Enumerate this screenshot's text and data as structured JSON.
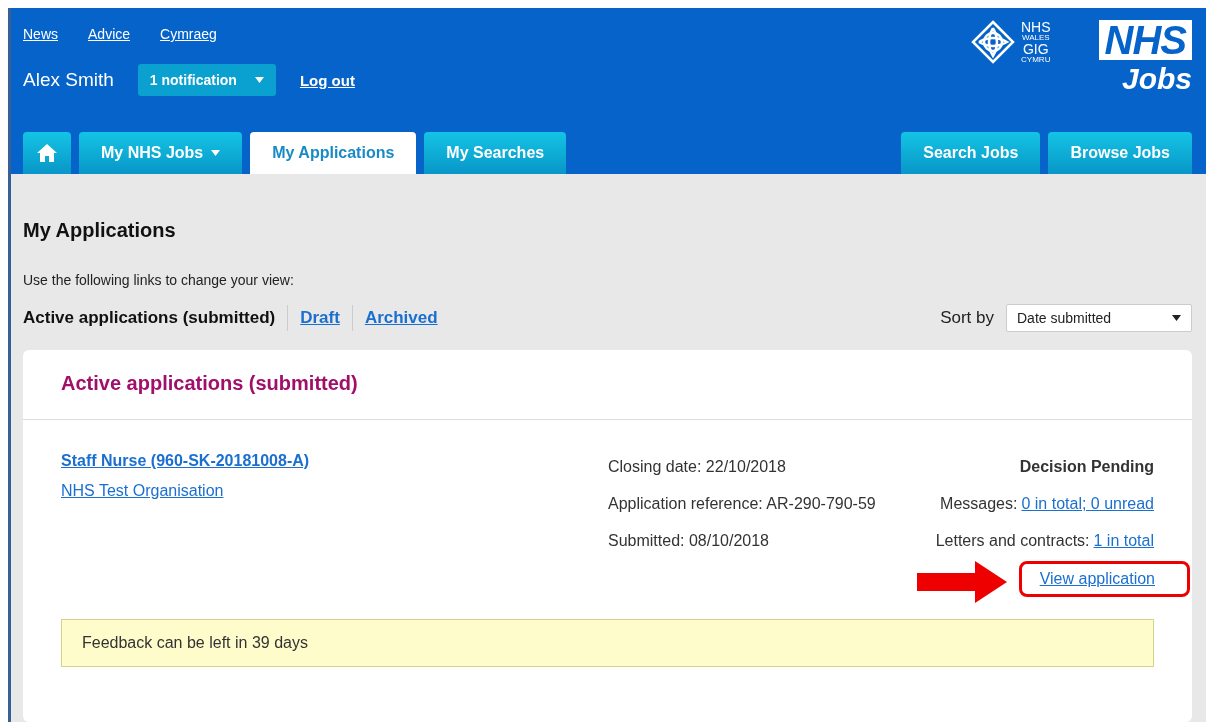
{
  "top_links": [
    "News",
    "Advice",
    "Cymraeg"
  ],
  "user": {
    "name": "Alex Smith",
    "notification": "1 notification",
    "logout": "Log out"
  },
  "wales_logo": {
    "line_1": "NHS",
    "line_2": "WALES",
    "line_3": "GIG",
    "line_4": "CYMRU"
  },
  "jobs_logo": {
    "mark": "NHS",
    "word": "Jobs"
  },
  "tabs": [
    {
      "kind": "home",
      "selected": false
    },
    {
      "kind": "menu",
      "label": "My NHS Jobs",
      "selected": false
    },
    {
      "kind": "tab",
      "label": "My Applications",
      "selected": true
    },
    {
      "kind": "tab",
      "label": "My Searches",
      "selected": false
    }
  ],
  "right_tabs": [
    {
      "label": "Search Jobs",
      "selected": false
    },
    {
      "label": "Browse Jobs",
      "selected": false
    }
  ],
  "page_title": "My Applications",
  "view_hint": "Use the following links to change your view:",
  "views": [
    {
      "label": "Active applications (submitted)",
      "selected": true
    },
    {
      "label": "Draft",
      "selected": false
    },
    {
      "label": "Archived",
      "selected": false
    }
  ],
  "sort": {
    "label": "Sort by",
    "value": "Date submitted"
  },
  "panel_title": "Active applications (submitted)",
  "application": {
    "title": "Staff Nurse (960-SK-20181008-A)",
    "organisation": "NHS Test Organisation",
    "details": [
      "Closing date: 22/10/2018",
      "Application reference: AR-290-790-59",
      "Submitted: 08/10/2018"
    ],
    "status": "Decision Pending",
    "messages": {
      "label": "Messages:",
      "link": "0 in total; 0 unread"
    },
    "letters": {
      "label": "Letters and contracts:",
      "link": "1 in total"
    },
    "view_link": "View application",
    "highlighted": true,
    "feedback": "Feedback can be left in 39 days"
  }
}
